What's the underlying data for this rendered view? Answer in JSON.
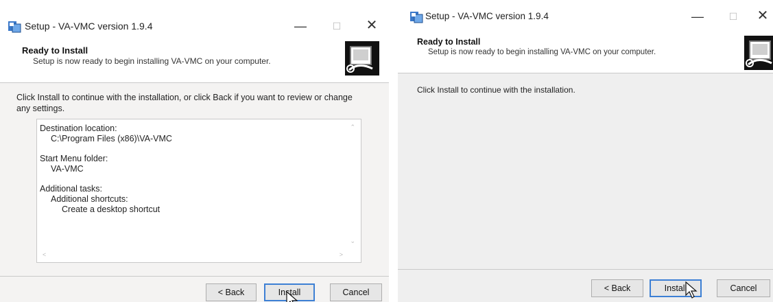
{
  "left_window": {
    "title": "Setup - VA-VMC version 1.9.4",
    "header_title": "Ready to Install",
    "header_subtitle": "Setup is now ready to begin installing VA-VMC on your computer.",
    "instruction": "Click Install to continue with the installation, or click Back if you want to review or change any settings.",
    "memo": {
      "destination_label": "Destination location:",
      "destination_value": "C:\\Program Files (x86)\\VA-VMC",
      "start_menu_label": "Start Menu folder:",
      "start_menu_value": "VA-VMC",
      "tasks_label": "Additional tasks:",
      "shortcuts_label": "Additional shortcuts:",
      "desktop_shortcut": "Create a desktop shortcut"
    },
    "buttons": {
      "back": "< Back",
      "install": "Install",
      "cancel": "Cancel"
    },
    "controls": {
      "minimize": "—",
      "maximize": "☐",
      "close": "✕"
    }
  },
  "right_window": {
    "title": "Setup - VA-VMC version 1.9.4",
    "header_title": "Ready to Install",
    "header_subtitle": "Setup is now ready to begin installing VA-VMC on your computer.",
    "instruction": "Click Install to continue with the installation.",
    "buttons": {
      "back": "< Back",
      "install": "Install",
      "cancel": "Cancel"
    },
    "controls": {
      "minimize": "—",
      "maximize": "☐",
      "close": "✕"
    }
  },
  "icons": {
    "app": "installer-app-icon",
    "wizard": "setup-wizard-computer-icon",
    "cursor": "mouse-pointer-icon"
  },
  "colors": {
    "default_button_border": "#3c7fd4",
    "window_background": "#f0f0f0"
  }
}
